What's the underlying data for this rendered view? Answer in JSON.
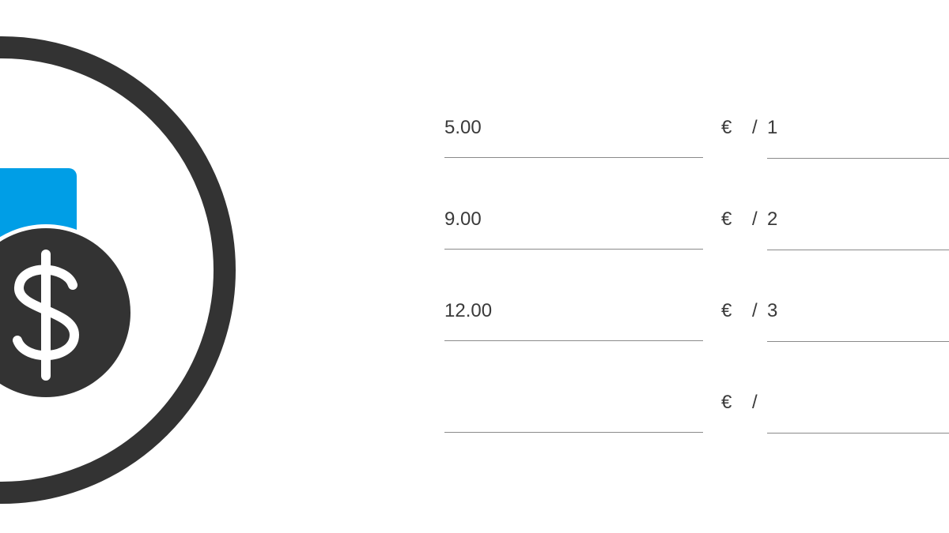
{
  "colors": {
    "ring": "#333333",
    "coin": "#333333",
    "bill": "#009ee6",
    "text": "#3a3a3a",
    "underline": "#8a8a8a"
  },
  "emblem": {
    "icon": "money-bag-dollar-icon"
  },
  "price_rows": [
    {
      "amount": "5.00",
      "currency": "€",
      "separator": "/",
      "quantity": "1"
    },
    {
      "amount": "9.00",
      "currency": "€",
      "separator": "/",
      "quantity": "2"
    },
    {
      "amount": "12.00",
      "currency": "€",
      "separator": "/",
      "quantity": "3"
    },
    {
      "amount": "",
      "currency": "€",
      "separator": "/",
      "quantity": ""
    }
  ]
}
